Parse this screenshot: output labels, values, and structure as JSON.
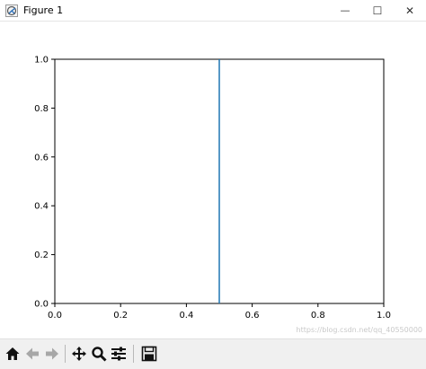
{
  "window": {
    "title": "Figure 1",
    "minimize_glyph": "—",
    "maximize_glyph": "☐",
    "close_glyph": "✕"
  },
  "chart_data": {
    "type": "line",
    "title": "",
    "xlabel": "",
    "ylabel": "",
    "xlim": [
      0.0,
      1.0
    ],
    "ylim": [
      0.0,
      1.0
    ],
    "xticks": [
      "0.0",
      "0.2",
      "0.4",
      "0.6",
      "0.8",
      "1.0"
    ],
    "yticks": [
      "0.0",
      "0.2",
      "0.4",
      "0.6",
      "0.8",
      "1.0"
    ],
    "grid": false,
    "series": [
      {
        "x": [
          0.5,
          0.5
        ],
        "y": [
          0.0,
          1.0
        ],
        "color": "#1f77b4"
      }
    ]
  },
  "toolbar": {
    "buttons": [
      "home-icon",
      "back-icon",
      "forward-icon",
      "pan-icon",
      "zoom-icon",
      "configure-subplots-icon",
      "save-icon"
    ]
  },
  "watermark": "https://blog.csdn.net/qq_40550000"
}
